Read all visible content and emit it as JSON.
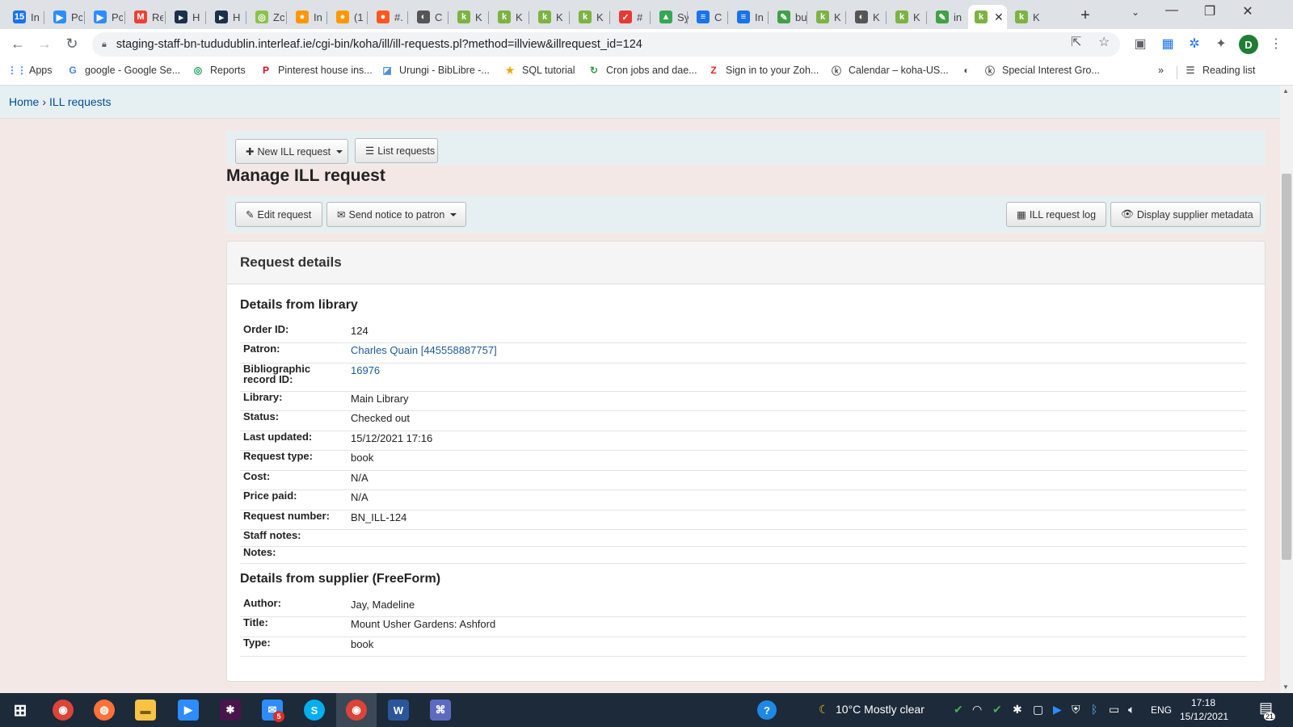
{
  "browser": {
    "tabs": [
      {
        "label": "In",
        "color": "#1a73e8",
        "glyph": "15"
      },
      {
        "label": "Pc",
        "color": "#2d8cff",
        "glyph": "▶"
      },
      {
        "label": "Pc",
        "color": "#2d8cff",
        "glyph": "▶"
      },
      {
        "label": "Re",
        "color": "#ea4335",
        "glyph": "M"
      },
      {
        "label": "H",
        "color": "#1d2f4a",
        "glyph": "▸"
      },
      {
        "label": "H",
        "color": "#1d2f4a",
        "glyph": "▸"
      },
      {
        "label": "Zc",
        "color": "#8bc34a",
        "glyph": "◎"
      },
      {
        "label": "In",
        "color": "#ff9800",
        "glyph": "●"
      },
      {
        "label": "(1",
        "color": "#ff9800",
        "glyph": "●"
      },
      {
        "label": "#.",
        "color": "#ff5722",
        "glyph": "●"
      },
      {
        "label": "C",
        "color": "#555555",
        "glyph": "◐"
      },
      {
        "label": "K",
        "color": "#7cb342",
        "glyph": "k"
      },
      {
        "label": "K",
        "color": "#7cb342",
        "glyph": "k"
      },
      {
        "label": "K",
        "color": "#7cb342",
        "glyph": "k"
      },
      {
        "label": "K",
        "color": "#7cb342",
        "glyph": "k"
      },
      {
        "label": "#",
        "color": "#e53935",
        "glyph": "✓"
      },
      {
        "label": "Sy",
        "color": "#34a853",
        "glyph": "▲"
      },
      {
        "label": "C",
        "color": "#1a73e8",
        "glyph": "≡"
      },
      {
        "label": "In",
        "color": "#1a73e8",
        "glyph": "≡"
      },
      {
        "label": "bu",
        "color": "#43a047",
        "glyph": "✎"
      },
      {
        "label": "K",
        "color": "#7cb342",
        "glyph": "k"
      },
      {
        "label": "K",
        "color": "#555555",
        "glyph": "◐"
      },
      {
        "label": "K",
        "color": "#7cb342",
        "glyph": "k"
      },
      {
        "label": "in",
        "color": "#43a047",
        "glyph": "✎"
      },
      {
        "label": "",
        "color": "#7cb342",
        "glyph": "k",
        "active": true
      },
      {
        "label": "K",
        "color": "#7cb342",
        "glyph": "k"
      }
    ],
    "new_tab": "+",
    "url": "staging-staff-bn-tududublin.interleaf.ie/cgi-bin/koha/ill/ill-requests.pl?method=illview&illrequest_id=124",
    "profile_initial": "D",
    "bookmarks": [
      {
        "label": "Apps",
        "icon": "⋮⋮",
        "color": "#4285f4"
      },
      {
        "label": "google - Google Se...",
        "icon": "G",
        "color": "#4285f4"
      },
      {
        "label": "Reports",
        "icon": "◎",
        "color": "#0f9d58"
      },
      {
        "label": "Pinterest house ins...",
        "icon": "P",
        "color": "#e60023"
      },
      {
        "label": "Urungi - BibLibre -...",
        "icon": "◪",
        "color": "#4a90d9"
      },
      {
        "label": "SQL tutorial",
        "icon": "★",
        "color": "#f4a300"
      },
      {
        "label": "Cron jobs and dae...",
        "icon": "↻",
        "color": "#2e9d3a"
      },
      {
        "label": "Sign in to your Zoh...",
        "icon": "Z",
        "color": "#e42527"
      },
      {
        "label": "Calendar – koha-US...",
        "icon": "ⓚ",
        "color": "#555555"
      },
      {
        "label": "",
        "icon": "◐",
        "color": "#555555"
      },
      {
        "label": "Special Interest Gro...",
        "icon": "ⓚ",
        "color": "#555555"
      }
    ],
    "bookmarks_more": "»",
    "reading_list": "Reading list"
  },
  "breadcrumb": {
    "home": "Home",
    "separator": "›",
    "current": "ILL requests"
  },
  "toolbar": {
    "new_request": "New ILL request",
    "list_requests": "List requests"
  },
  "page_title": "Manage ILL request",
  "actions": {
    "edit": "Edit request",
    "send_notice": "Send notice to patron",
    "log": "ILL request log",
    "metadata": "Display supplier metadata"
  },
  "panel": {
    "title": "Request details",
    "library_heading": "Details from library",
    "library_rows": [
      {
        "label": "Order ID:",
        "value": "124"
      },
      {
        "label": "Patron:",
        "value": "Charles Quain [445558887757]",
        "link": true
      },
      {
        "label": "Bibliographic record ID:",
        "value": "16976",
        "link": true
      },
      {
        "label": "Library:",
        "value": "Main Library"
      },
      {
        "label": "Status:",
        "value": "Checked out"
      },
      {
        "label": "Last updated:",
        "value": "15/12/2021 17:16"
      },
      {
        "label": "Request type:",
        "value": "book"
      },
      {
        "label": "Cost:",
        "value": "N/A"
      },
      {
        "label": "Price paid:",
        "value": "N/A"
      },
      {
        "label": "Request number:",
        "value": "BN_ILL-124"
      },
      {
        "label": "Staff notes:",
        "value": ""
      },
      {
        "label": "Notes:",
        "value": ""
      }
    ],
    "supplier_heading": "Details from supplier (FreeForm)",
    "supplier_rows": [
      {
        "label": "Author:",
        "value": "Jay, Madeline"
      },
      {
        "label": "Title:",
        "value": "Mount Usher Gardens: Ashford"
      },
      {
        "label": "Type:",
        "value": "book"
      }
    ]
  },
  "taskbar": {
    "weather": "10°C  Mostly clear",
    "language": "ENG",
    "time": "17:18",
    "date": "15/12/2021",
    "notifications": "21",
    "badge": "5"
  }
}
